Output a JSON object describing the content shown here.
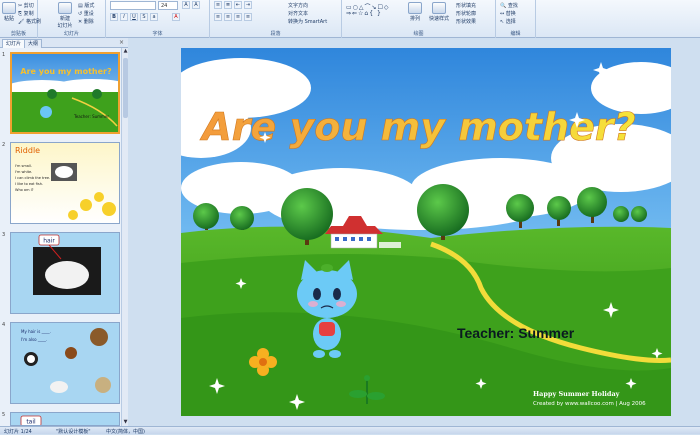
{
  "ribbon": {
    "clipboard": {
      "paste": "粘贴",
      "cut": "剪切",
      "copy": "复制",
      "format_painter": "格式刷",
      "label": "剪贴板"
    },
    "slides": {
      "new_slide": "新建\n幻灯片",
      "layout": "版式",
      "reset": "重设",
      "delete": "删除",
      "label": "幻灯片"
    },
    "font": {
      "size": "24",
      "label": "字体"
    },
    "paragraph": {
      "text_direction": "文字方向",
      "align_text": "对齐文本",
      "smartart": "转换为 SmartArt",
      "label": "段落"
    },
    "drawing": {
      "arrange": "排列",
      "quick_styles": "快速样式",
      "fill": "形状填充",
      "outline": "形状轮廓",
      "effects": "形状效果",
      "label": "绘图"
    },
    "editing": {
      "find": "查找",
      "replace": "替换",
      "select": "选择",
      "label": "编辑"
    }
  },
  "panel": {
    "tab_slides": "幻灯片",
    "tab_outline": "大纲",
    "close": "×",
    "thumbnails": [
      {
        "num": "1",
        "title": "Are you my mother?",
        "teacher": "Teacher: Summer"
      },
      {
        "num": "2",
        "title": "Riddle",
        "lines": [
          "I'm small.",
          "I'm white.",
          "I can climb the tree.",
          "I like to eat fish.",
          "Who am I?"
        ]
      },
      {
        "num": "3",
        "label": "hair"
      },
      {
        "num": "4",
        "lines": [
          "My hair is ____.",
          "I'm also ____."
        ]
      },
      {
        "num": "5",
        "label": "tail"
      }
    ]
  },
  "slide": {
    "title": "Are you my mother?",
    "teacher": "Teacher: Summer",
    "footer1": "Happy Summer Holiday",
    "footer2": "Created by www.wallcoo.com | Aug 2006"
  },
  "status": {
    "slide_info": "幻灯片 1/24",
    "theme": "\"默认设计模板\"",
    "language": "中文(简体，中国)"
  },
  "colors": {
    "sky_top": "#3a8fe0",
    "grass": "#3ea11c",
    "title_gradient": [
      "#f6a640",
      "#f5e23a"
    ]
  }
}
